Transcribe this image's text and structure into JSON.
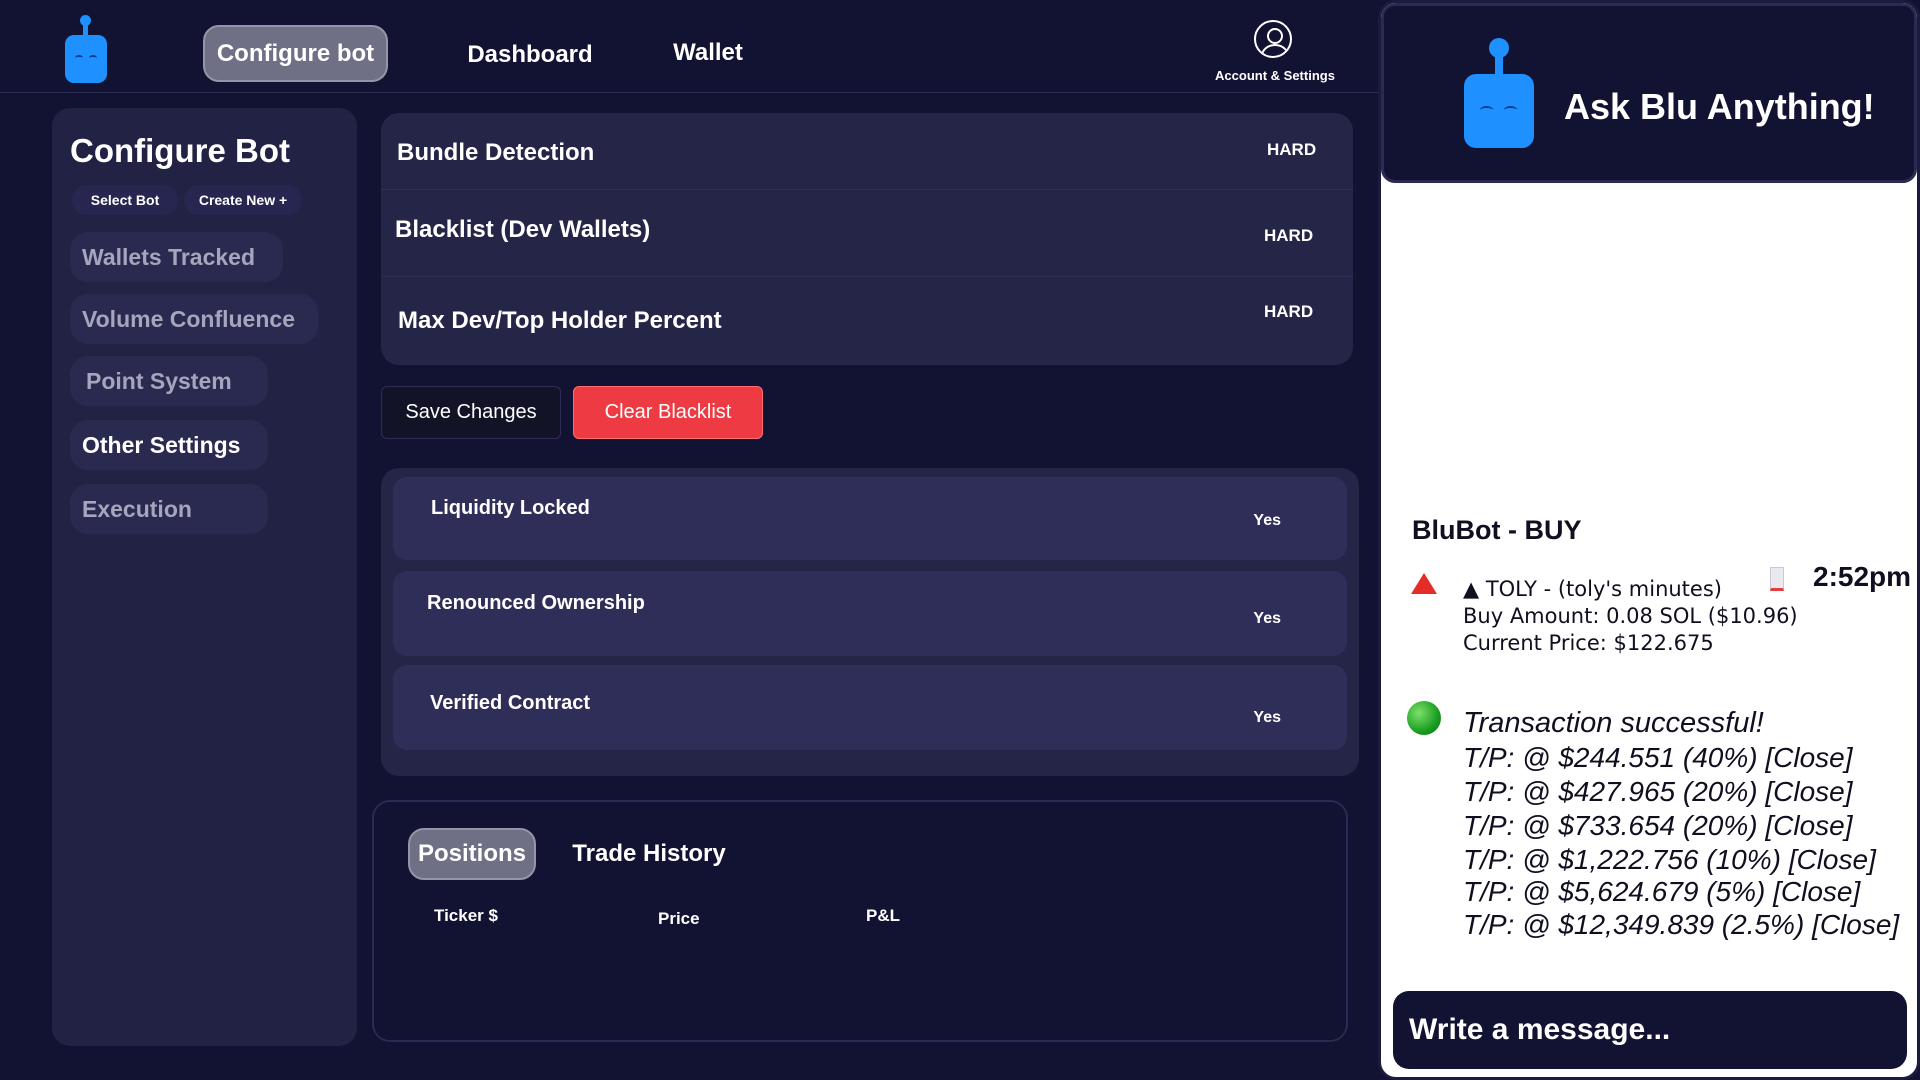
{
  "nav": {
    "configure_bot": "Configure bot",
    "dashboard": "Dashboard",
    "wallet": "Wallet",
    "account": "Account & Settings"
  },
  "sidebar": {
    "title": "Configure Bot",
    "select_bot": "Select Bot",
    "create_new": "Create New +",
    "items": [
      {
        "label": "Wallets Tracked"
      },
      {
        "label": "Volume Confluence"
      },
      {
        "label": "Point System"
      },
      {
        "label": "Other Settings"
      },
      {
        "label": "Execution"
      }
    ]
  },
  "filters": [
    {
      "label": "Bundle Detection",
      "value": "HARD"
    },
    {
      "label": "Blacklist (Dev Wallets)",
      "value": "HARD"
    },
    {
      "label": "Max Dev/Top Holder Percent",
      "value": "HARD"
    }
  ],
  "actions": {
    "save": "Save Changes",
    "clear": "Clear Blacklist"
  },
  "checks": [
    {
      "label": "Liquidity Locked",
      "value": "Yes"
    },
    {
      "label": "Renounced Ownership",
      "value": "Yes"
    },
    {
      "label": "Verified Contract",
      "value": "Yes"
    }
  ],
  "positions": {
    "tabs": [
      "Positions",
      "Trade History"
    ],
    "columns": [
      "Ticker $",
      "Price",
      "P&L"
    ]
  },
  "chat": {
    "title": "Ask Blu Anything!",
    "message_header": "BluBot - BUY",
    "time": "2:52pm",
    "token_line": "▲ TOLY - (toly's minutes)",
    "buy_amount": "Buy Amount: 0.08 SOL ($10.96)",
    "current_price": "Current Price: $122.675",
    "success": "Transaction successful!",
    "tp_lines": [
      "T/P: @ $244.551 (40%) [Close]",
      "T/P: @ $427.965 (20%) [Close]",
      "T/P: @ $733.654 (20%) [Close]",
      "T/P: @ $1,222.756 (10%) [Close]",
      "T/P: @ $5,624.679 (5%) [Close]",
      "T/P: @ $12,349.839 (2.5%) [Close]"
    ],
    "input_placeholder": "Write a message..."
  },
  "colors": {
    "bg": "#121233",
    "panel": "#252548",
    "accent_blue": "#1e90ff",
    "danger": "#ee3b43"
  }
}
